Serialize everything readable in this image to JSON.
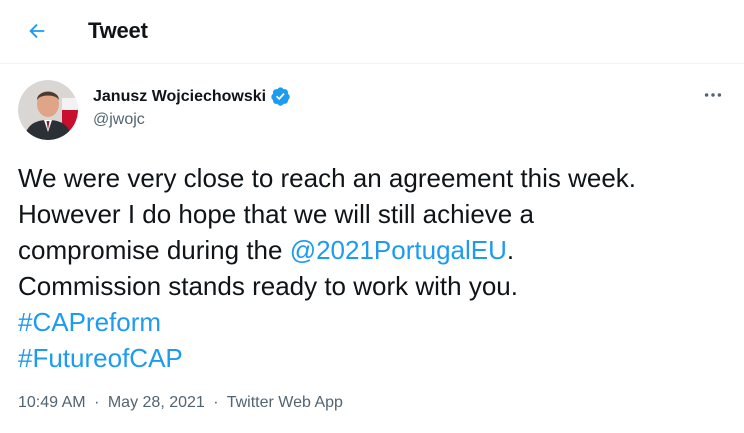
{
  "header": {
    "back_icon": "arrow-left-icon",
    "title": "Tweet"
  },
  "tweet": {
    "author": {
      "name": "Janusz Wojciechowski",
      "handle": "@jwojc",
      "verified_icon": "verified-badge-icon"
    },
    "more_icon": "more-horizontal-icon",
    "text": {
      "line1": "We were very close to reach an agreement this week.",
      "line2": "However I do hope that we will still achieve a",
      "line3_prefix": "compromise during the ",
      "mention": "@2021PortugalEU",
      "line3_suffix": ".",
      "line4": "Commission stands ready to work with you.",
      "hashtag1": "#CAPreform",
      "hashtag2": "#FutureofCAP"
    },
    "meta": {
      "time": "10:49 AM",
      "separator": "·",
      "date": "May 28, 2021",
      "source": "Twitter Web App"
    }
  },
  "colors": {
    "accent": "#1d9bf0",
    "text": "#0f1419",
    "secondary": "#536471"
  }
}
